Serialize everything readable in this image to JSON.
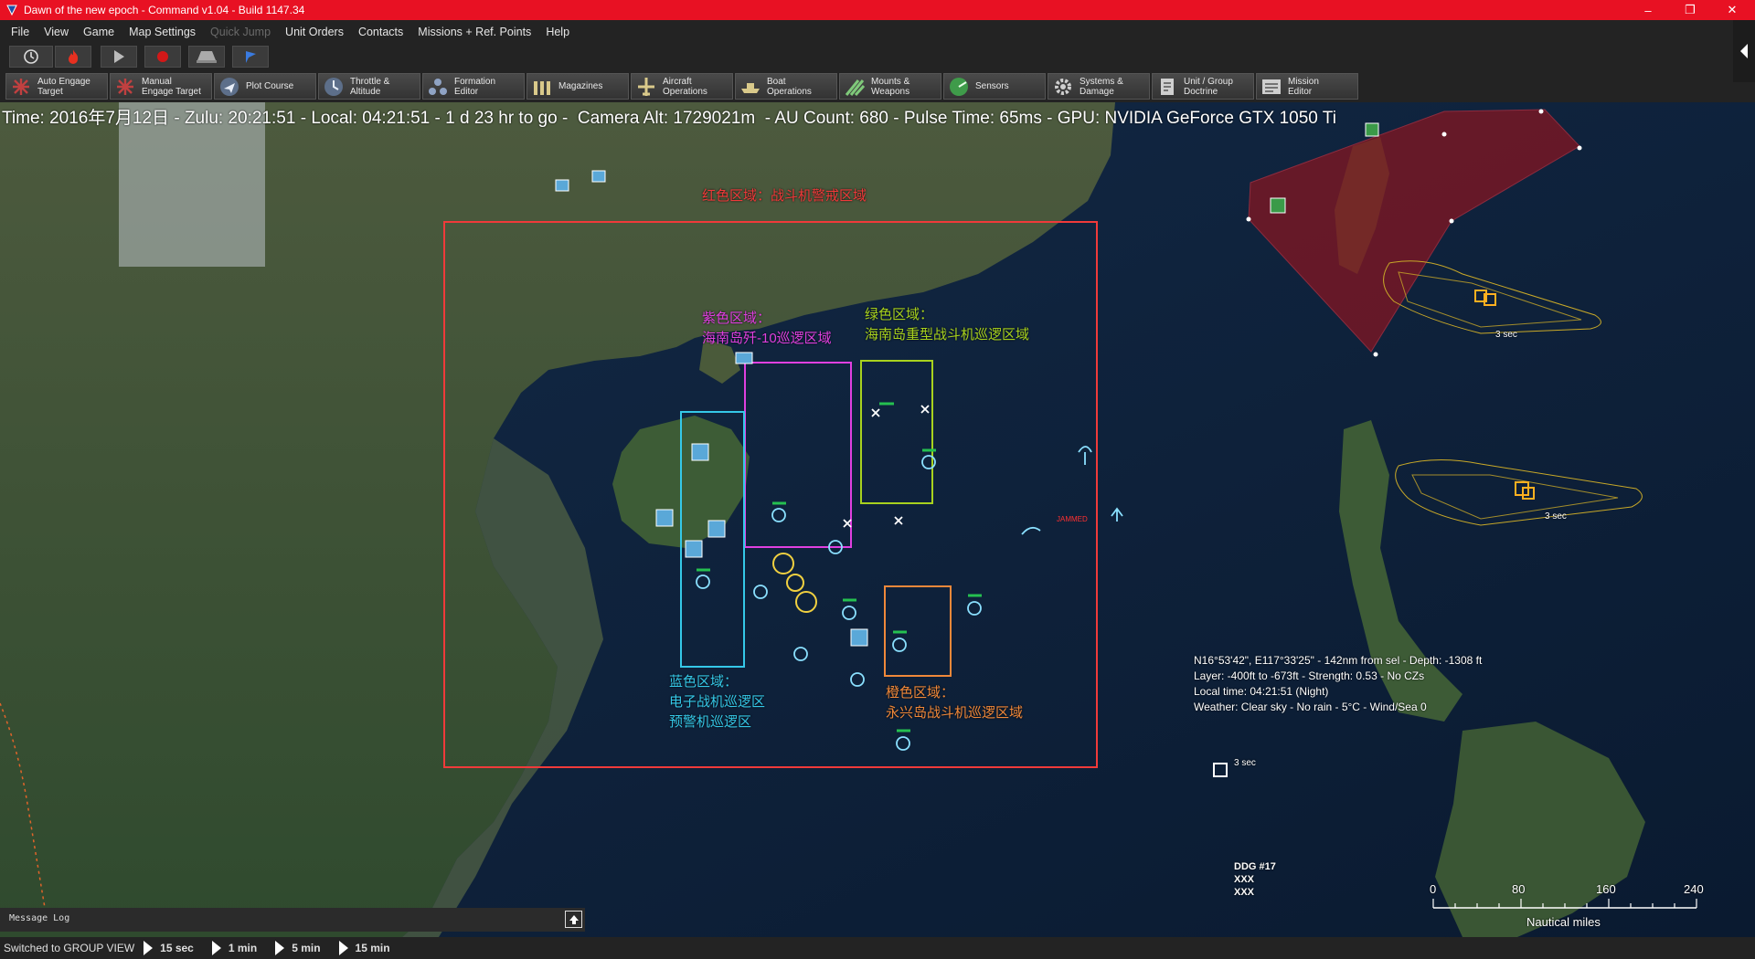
{
  "window": {
    "title": "Dawn of the new epoch - Command v1.04 - Build 1147.34",
    "controls": [
      "–",
      "❐",
      "✕"
    ]
  },
  "menu": [
    {
      "label": "File",
      "enabled": true
    },
    {
      "label": "View",
      "enabled": true
    },
    {
      "label": "Game",
      "enabled": true
    },
    {
      "label": "Map Settings",
      "enabled": true
    },
    {
      "label": "Quick Jump",
      "enabled": false
    },
    {
      "label": "Unit Orders",
      "enabled": true
    },
    {
      "label": "Contacts",
      "enabled": true
    },
    {
      "label": "Missions + Ref. Points",
      "enabled": true
    },
    {
      "label": "Help",
      "enabled": true
    }
  ],
  "toolbar1": [
    "clock-icon",
    "fire-icon",
    "play-icon",
    "record-icon",
    "tank-icon",
    "flag-icon"
  ],
  "toolbar2": [
    {
      "line1": "Auto Engage",
      "line2": "Target",
      "icon": "auto-engage-icon"
    },
    {
      "line1": "Manual",
      "line2": "Engage Target",
      "icon": "manual-engage-icon"
    },
    {
      "line1": "Plot Course",
      "line2": "",
      "icon": "plot-course-icon"
    },
    {
      "line1": "Throttle &",
      "line2": "Altitude",
      "icon": "throttle-icon"
    },
    {
      "line1": "Formation",
      "line2": "Editor",
      "icon": "formation-icon"
    },
    {
      "line1": "Magazines",
      "line2": "",
      "icon": "magazines-icon"
    },
    {
      "line1": "Aircraft",
      "line2": "Operations",
      "icon": "aircraft-icon"
    },
    {
      "line1": "Boat",
      "line2": "Operations",
      "icon": "boat-icon"
    },
    {
      "line1": "Mounts &",
      "line2": "Weapons",
      "icon": "weapons-icon"
    },
    {
      "line1": "Sensors",
      "line2": "",
      "icon": "sensors-icon"
    },
    {
      "line1": "Systems &",
      "line2": "Damage",
      "icon": "systems-icon"
    },
    {
      "line1": "Unit / Group",
      "line2": "Doctrine",
      "icon": "doctrine-icon"
    },
    {
      "line1": "Mission",
      "line2": "Editor",
      "icon": "mission-editor-icon"
    }
  ],
  "status": {
    "time": "Time: 2016年7月12日",
    "zulu": "Zulu: 20:21:51",
    "local": "Local: 04:21:51",
    "remaining": "1 d 23 hr to go",
    "camera": "Camera Alt: 1729021m",
    "au_count": "AU Count: 680",
    "pulse": "Pulse Time: 65ms",
    "gpu": "GPU: NVIDIA GeForce GTX 1050 Ti"
  },
  "zones": {
    "red": {
      "line1": "红色区域：战斗机警戒区域",
      "line2": "",
      "color": "#f03a3a"
    },
    "purple": {
      "line1": "紫色区域：",
      "line2": "海南岛歼-10巡逻区域",
      "color": "#e040e0"
    },
    "green": {
      "line1": "绿色区域：",
      "line2": "海南岛重型战斗机巡逻区域",
      "color": "#a8d21e"
    },
    "blue": {
      "line1": "蓝色区域：",
      "line2": "电子战机巡逻区",
      "line3": "预警机巡逻区",
      "color": "#35c8e8"
    },
    "orange": {
      "line1": "橙色区域：",
      "line2": "永兴岛战斗机巡逻区域",
      "color": "#f0883a"
    }
  },
  "cursor_info": {
    "line1": "N16°53'42\", E117°33'25\" - 142nm from sel - Depth: -1308 ft",
    "line2": "Layer: -400ft to -673ft - Strength: 0.53 - No CZs",
    "line3": "Local time: 04:21:51 (Night)",
    "line4": "Weather: Clear sky - No rain - 5°C - Wind/Sea 0"
  },
  "map_labels": {
    "ddg": "DDG #17",
    "xxx1": "XXX",
    "xxx2": "XXX",
    "three_sec": "3 sec",
    "jammed": "JAMMED"
  },
  "message_log": {
    "label": "Message Log"
  },
  "bottom": {
    "status": "Switched to GROUP VIEW",
    "speeds": [
      "15 sec",
      "1 min",
      "5 min",
      "15 min"
    ]
  },
  "scale": {
    "ticks": [
      "0",
      "80",
      "160",
      "240"
    ],
    "unit": "Nautical miles"
  }
}
